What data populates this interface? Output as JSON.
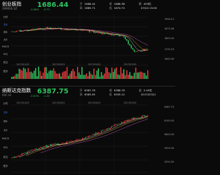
{
  "chart_a": {
    "title": "创业板指",
    "code": "399006.SZ",
    "price": "1686.44",
    "change": "-0.40%",
    "change_abs": "-0.71",
    "stats": [
      {
        "label": "开",
        "value": "1686.44"
      },
      {
        "label": "高",
        "value": "1685.71"
      },
      {
        "label": "收",
        "value": "1686.38"
      },
      {
        "label": "低",
        "value": "1674.72"
      },
      {
        "label": "额",
        "value": "453亿"
      },
      {
        "label": "",
        "value": "07/24 15:00"
      }
    ],
    "side_tabs": [
      "分时",
      "日K",
      "周K",
      "月K",
      "MACD",
      "KDJ",
      "成交",
      "更多"
    ],
    "active_tab": "日K",
    "y_labels": [
      "1958.12",
      "1875.38",
      "1800.00",
      "1735.53",
      "1640.06"
    ],
    "x_labels": [
      "2017/01/03",
      "2017/03/01",
      "2017/05/02",
      "2017/07/03"
    ],
    "volume_label": "成交量",
    "volume_value": "400亿",
    "colors": {
      "up": "#e83b3b",
      "down": "#2ec45f",
      "accent": "#3a8cff"
    }
  },
  "chart_b": {
    "title": "纳斯达克指数",
    "code": "IXIC.GI",
    "price": "6387.75",
    "change": "-0.01%",
    "change_abs": "-1.22",
    "stats": [
      {
        "label": "开",
        "value": "6387.76"
      },
      {
        "label": "高",
        "value": "6383.05"
      },
      {
        "label": "收",
        "value": "6388.76"
      },
      {
        "label": "低",
        "value": "6355.12"
      },
      {
        "label": "量",
        "value": "2.45亿"
      },
      {
        "label": "",
        "value": "2017/07/21"
      }
    ],
    "side_tabs": [
      "分时",
      "日K",
      "周K",
      "月K",
      "MACD",
      "KDJ",
      "成交",
      "更多"
    ],
    "active_tab": "日K",
    "y_labels": [
      "6387.75",
      "6100.00",
      "5800.00",
      "5500.00",
      "5250.00"
    ],
    "x_labels": [
      "2017/01/03",
      "2017/03/01",
      "2017/05/01",
      "2017/07/03"
    ],
    "colors": {
      "up": "#e83b3b",
      "down": "#2ec45f",
      "accent": "#3a8cff"
    }
  }
}
